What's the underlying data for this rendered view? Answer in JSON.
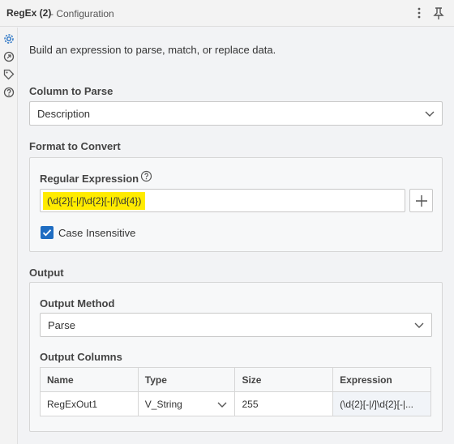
{
  "titlebar": {
    "title": "RegEx (2)",
    "subtitle": "- Configuration",
    "more_icon": "kebab-icon",
    "pin_icon": "pin-icon"
  },
  "rail": {
    "icons": [
      "gear-icon",
      "refresh-icon",
      "tag-icon",
      "help-icon"
    ]
  },
  "intro": "Build an expression to parse, match, or replace data.",
  "column_to_parse": {
    "label": "Column to Parse",
    "value": "Description"
  },
  "format_to_convert": {
    "label": "Format to Convert",
    "regex_label": "Regular Expression",
    "regex_value": "(\\d{2}[-|/]\\d{2}[-|/]\\d{4})",
    "case_insensitive_label": "Case Insensitive",
    "case_insensitive_checked": true
  },
  "output": {
    "label": "Output",
    "method_label": "Output Method",
    "method_value": "Parse",
    "columns_label": "Output Columns",
    "columns": {
      "headers": [
        "Name",
        "Type",
        "Size",
        "Expression"
      ]
    },
    "rows": [
      {
        "name": "RegExOut1",
        "type": "V_String",
        "size": "255",
        "expression": "(\\d{2}[-|/]\\d{2}[-|..."
      }
    ]
  },
  "colors": {
    "accent": "#1f6dc2",
    "highlight": "#ffeb00"
  }
}
